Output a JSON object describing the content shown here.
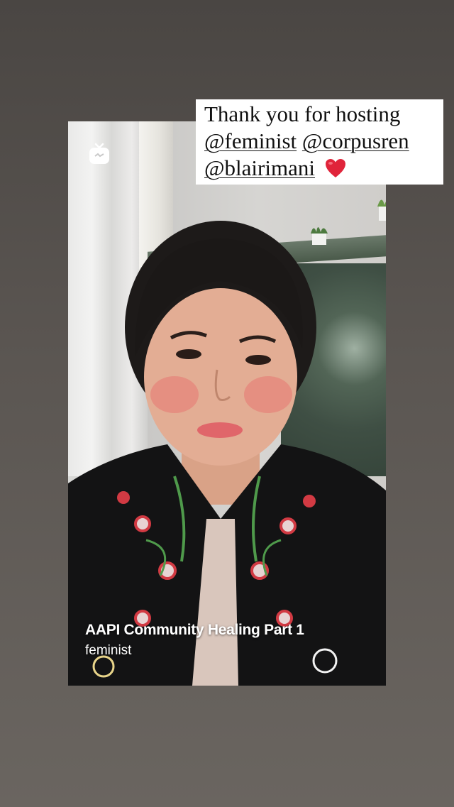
{
  "sticker": {
    "line1": "Thank you for hosting",
    "mention1": "@feminist",
    "mention2": "@corpusren",
    "mention3": "@blairimani",
    "emoji_icon": "red-heart-icon"
  },
  "post": {
    "media_icon": "igtv-icon",
    "title": "AAPI Community Healing Part 1",
    "username": "feminist"
  },
  "colors": {
    "background_top": "#4a4643",
    "background_bottom": "#6a6560",
    "sticker_bg": "#ffffff",
    "heart": "#e0243a"
  }
}
